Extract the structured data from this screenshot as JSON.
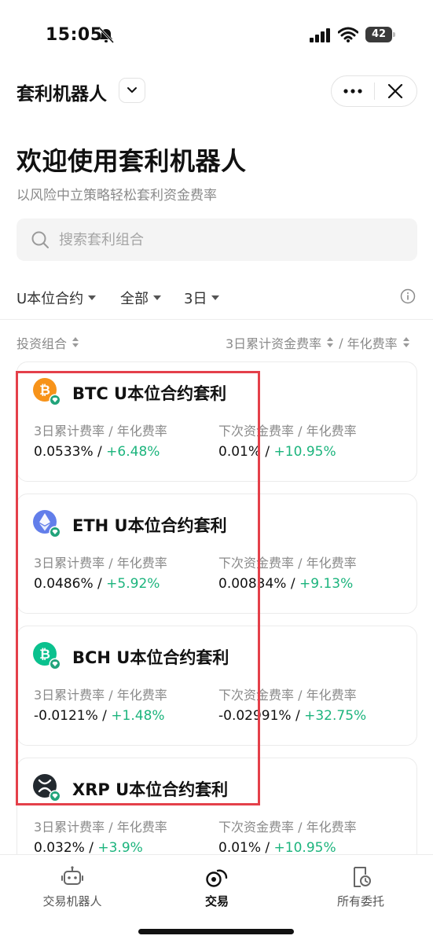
{
  "status_bar": {
    "time": "15:05",
    "battery": "42"
  },
  "header": {
    "title": "套利机器人"
  },
  "page": {
    "heading": "欢迎使用套利机器人",
    "subtitle": "以风险中立策略轻松套利资金费率"
  },
  "search": {
    "placeholder": "搜索套利组合"
  },
  "filters": {
    "contract_type": "U本位合约",
    "scope": "全部",
    "period": "3日"
  },
  "columns": {
    "left": "投资组合",
    "right_a": "3日累计资金费率",
    "right_sep": "/",
    "right_b": "年化费率"
  },
  "cards": [
    {
      "coin": "BTC",
      "name": "BTC U本位合约套利",
      "label_a": "3日累计费率 / 年化费率",
      "value_a": "0.0533% / ",
      "value_a_pos": "+6.48%",
      "label_b": "下次资金费率 / 年化费率",
      "value_b": "0.01% / ",
      "value_b_pos": "+10.95%",
      "color": "#f7931a"
    },
    {
      "coin": "ETH",
      "name": "ETH U本位合约套利",
      "label_a": "3日累计费率 / 年化费率",
      "value_a": "0.0486% / ",
      "value_a_pos": "+5.92%",
      "label_b": "下次资金费率 / 年化费率",
      "value_b": "0.00834% / ",
      "value_b_pos": "+9.13%",
      "color": "#627eea"
    },
    {
      "coin": "BCH",
      "name": "BCH U本位合约套利",
      "label_a": "3日累计费率 / 年化费率",
      "value_a": "-0.0121% / ",
      "value_a_pos": "+1.48%",
      "label_b": "下次资金费率 / 年化费率",
      "value_b": "-0.02991% / ",
      "value_b_pos": "+32.75%",
      "color": "#0ac18e"
    },
    {
      "coin": "XRP",
      "name": "XRP U本位合约套利",
      "label_a": "3日累计费率 / 年化费率",
      "value_a": "0.032% / ",
      "value_a_pos": "+3.9%",
      "label_b": "下次资金费率 / 年化费率",
      "value_b": "0.01% / ",
      "value_b_pos": "+10.95%",
      "color": "#23292f"
    }
  ],
  "bottom_nav": {
    "items": [
      {
        "label": "交易机器人",
        "icon": "robot-icon"
      },
      {
        "label": "交易",
        "icon": "trade-icon",
        "active": true
      },
      {
        "label": "所有委托",
        "icon": "orders-icon"
      }
    ]
  },
  "colors": {
    "positive": "#1cb47d",
    "highlight": "#e4404a"
  }
}
